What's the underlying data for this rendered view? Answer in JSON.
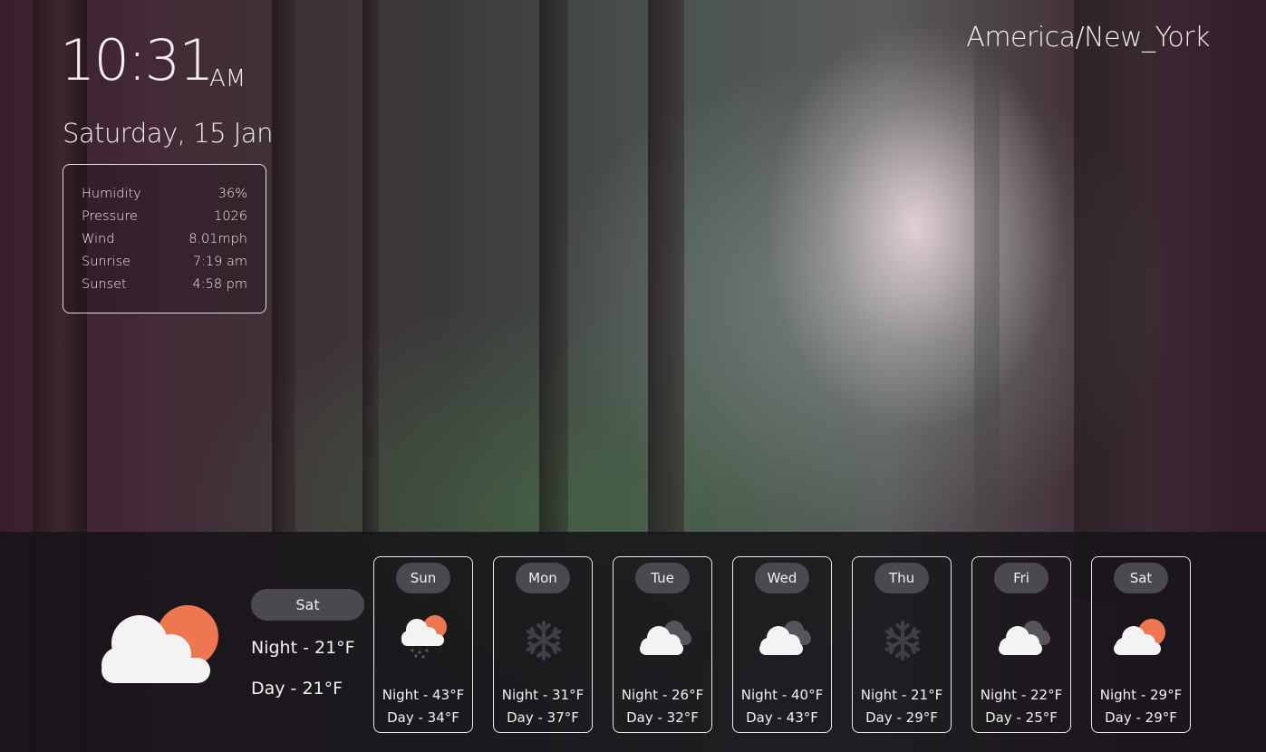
{
  "clock": {
    "time": "10:31",
    "ampm": "AM"
  },
  "date": "Saturday, 15 Jan",
  "timezone": "America/New_York",
  "details": [
    {
      "label": "Humidity",
      "value": "36%"
    },
    {
      "label": "Pressure",
      "value": "1026"
    },
    {
      "label": "Wind",
      "value": "8.01mph"
    },
    {
      "label": "Sunrise",
      "value": "7:19 am"
    },
    {
      "label": "Sunset",
      "value": "4:58 pm"
    }
  ],
  "today": {
    "day": "Sat",
    "night": "Night - 21°F",
    "day_temp": "Day - 21°F",
    "icon": "partly-cloudy-icon"
  },
  "forecast": [
    {
      "day": "Sun",
      "night": "Night - 43°F",
      "day_temp": "Day - 34°F",
      "icon": "rain-partly-cloudy-icon"
    },
    {
      "day": "Mon",
      "night": "Night - 31°F",
      "day_temp": "Day - 37°F",
      "icon": "snowflake-icon"
    },
    {
      "day": "Tue",
      "night": "Night - 26°F",
      "day_temp": "Day - 32°F",
      "icon": "cloudy-icon"
    },
    {
      "day": "Wed",
      "night": "Night - 40°F",
      "day_temp": "Day - 43°F",
      "icon": "cloudy-icon"
    },
    {
      "day": "Thu",
      "night": "Night - 21°F",
      "day_temp": "Day - 29°F",
      "icon": "snowflake-icon"
    },
    {
      "day": "Fri",
      "night": "Night - 22°F",
      "day_temp": "Day - 25°F",
      "icon": "cloudy-icon"
    },
    {
      "day": "Sat",
      "night": "Night - 29°F",
      "day_temp": "Day - 29°F",
      "icon": "partly-cloudy-icon"
    }
  ],
  "colors": {
    "sun": "#ee7650",
    "cloud": "#f3f3f3",
    "cloud_dark": "#55555a",
    "pill": "#4a4950",
    "snow": "#3f3f44"
  }
}
